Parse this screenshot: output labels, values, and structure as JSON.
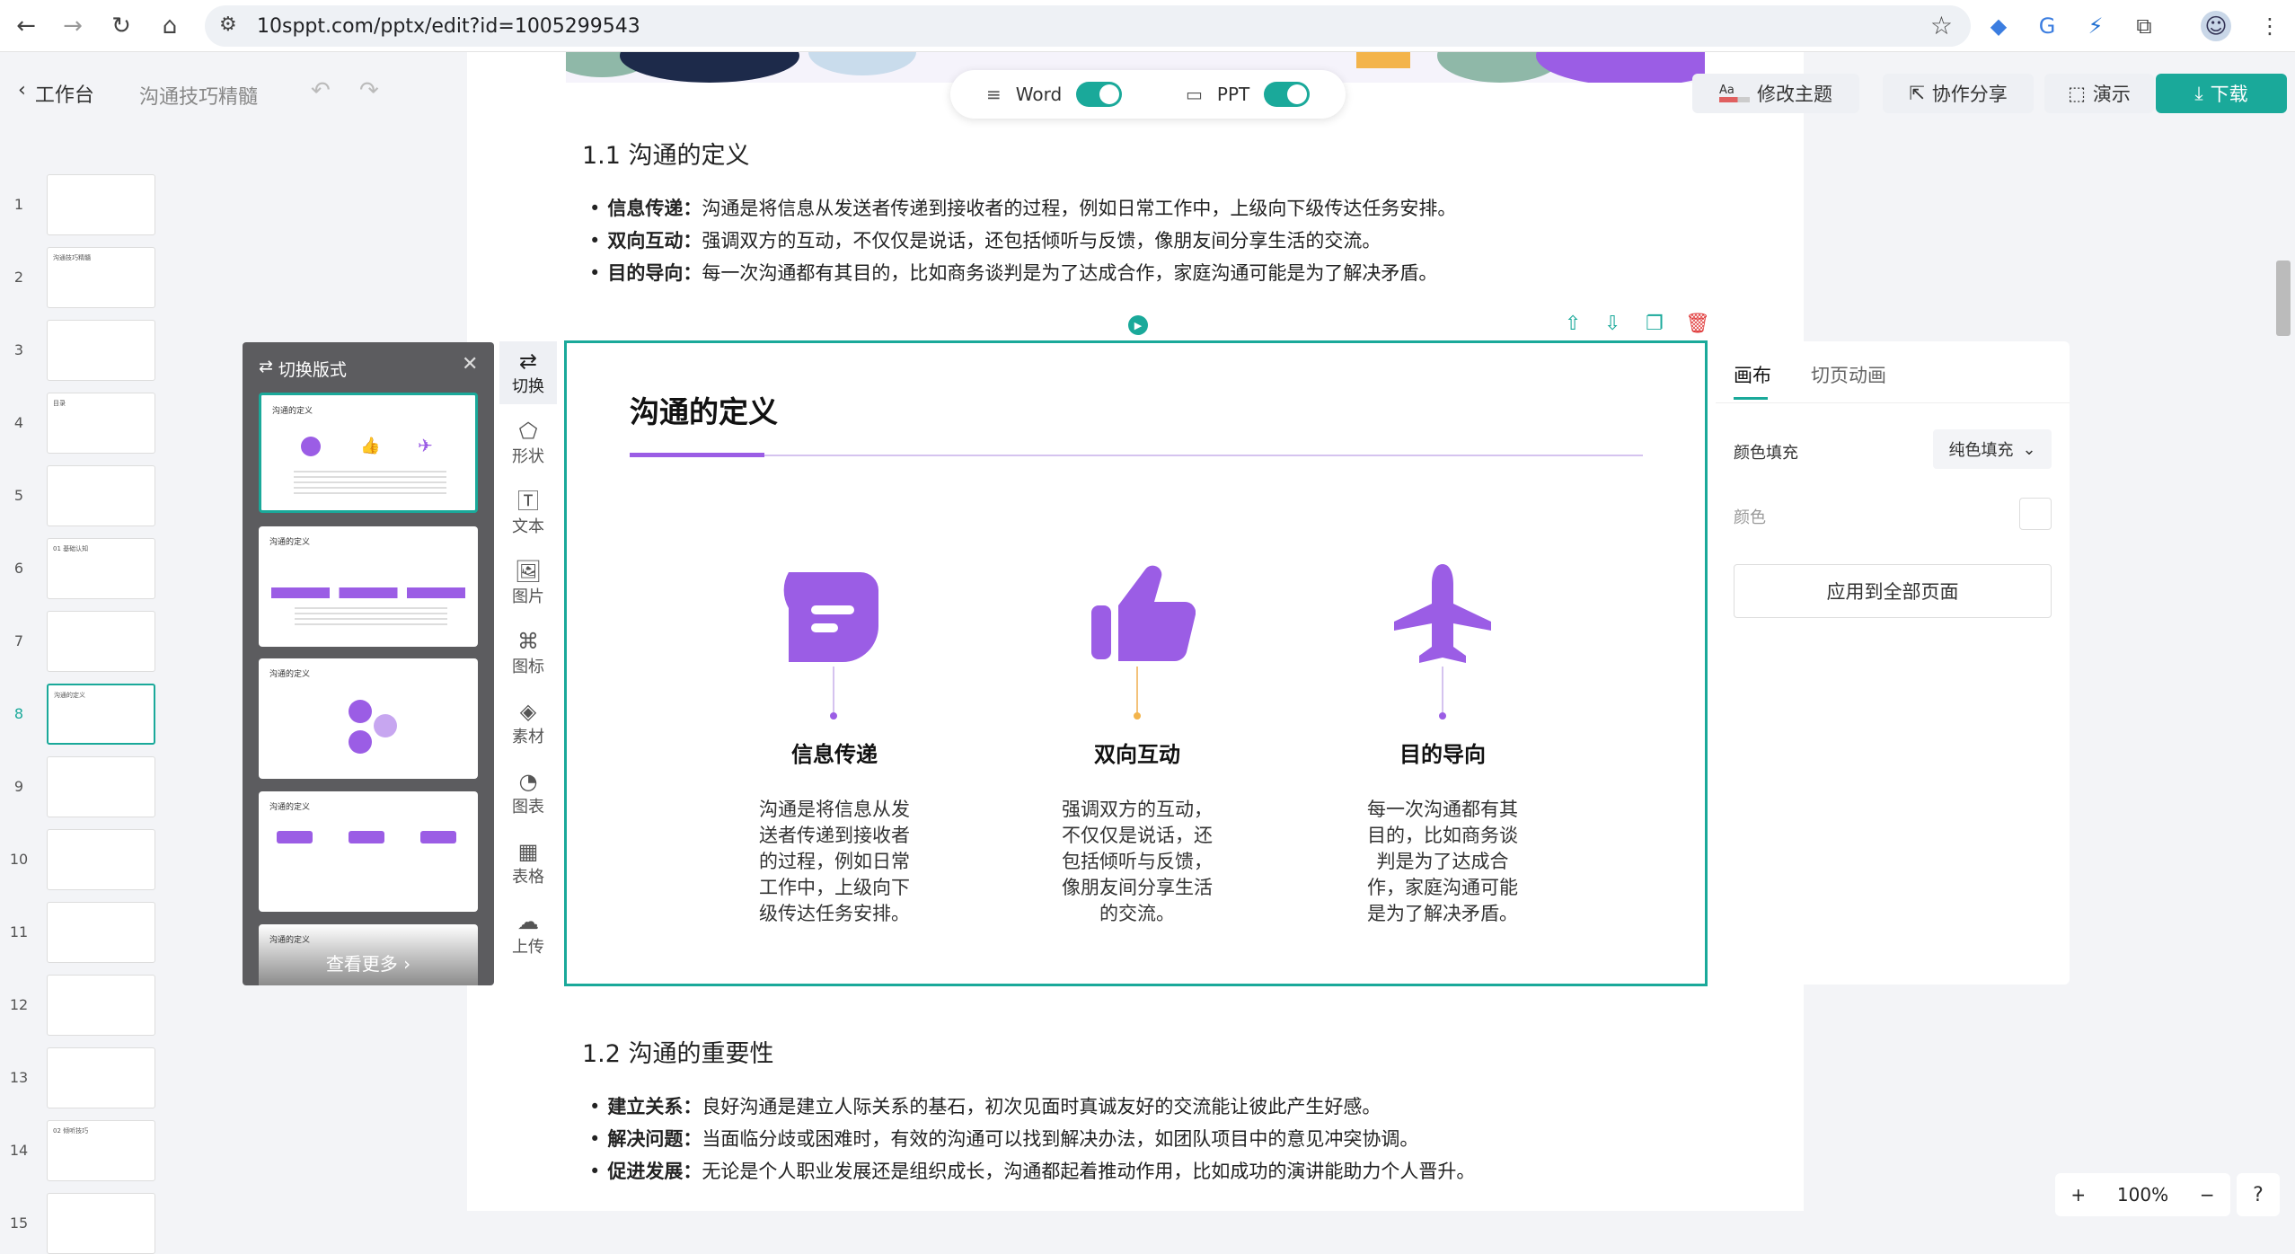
{
  "browser": {
    "url": "10sppt.com/pptx/edit?id=1005299543"
  },
  "header": {
    "workbench": "工作台",
    "doc_title": "沟通技巧精髓",
    "toggle_word": "Word",
    "toggle_ppt": "PPT",
    "theme_label": "修改主题",
    "theme_aa": "Aa",
    "share": "协作分享",
    "present": "演示",
    "download": "下载"
  },
  "thumbnails": [
    {
      "num": "1",
      "text": ""
    },
    {
      "num": "2",
      "text": "沟通技巧精髓"
    },
    {
      "num": "3",
      "text": ""
    },
    {
      "num": "4",
      "text": "目录"
    },
    {
      "num": "5",
      "text": ""
    },
    {
      "num": "6",
      "text": "01 基础认知"
    },
    {
      "num": "7",
      "text": ""
    },
    {
      "num": "8",
      "text": "沟通的定义"
    },
    {
      "num": "9",
      "text": ""
    },
    {
      "num": "10",
      "text": ""
    },
    {
      "num": "11",
      "text": ""
    },
    {
      "num": "12",
      "text": ""
    },
    {
      "num": "13",
      "text": ""
    },
    {
      "num": "14",
      "text": "02 倾听技巧"
    },
    {
      "num": "15",
      "text": ""
    }
  ],
  "doc": {
    "section1_title": "1.1 沟通的定义",
    "section1_items": [
      {
        "label": "信息传递：",
        "text": "沟通是将信息从发送者传递到接收者的过程，例如日常工作中，上级向下级传达任务安排。"
      },
      {
        "label": "双向互动：",
        "text": "强调双方的互动，不仅仅是说话，还包括倾听与反馈，像朋友间分享生活的交流。"
      },
      {
        "label": "目的导向：",
        "text": "每一次沟通都有其目的，比如商务谈判是为了达成合作，家庭沟通可能是为了解决矛盾。"
      }
    ],
    "section2_title": "1.2 沟通的重要性",
    "section2_items": [
      {
        "label": "建立关系：",
        "text": "良好沟通是建立人际关系的基石，初次见面时真诚友好的交流能让彼此产生好感。"
      },
      {
        "label": "解决问题：",
        "text": "当面临分歧或困难时，有效的沟通可以找到解决办法，如团队项目中的意见冲突协调。"
      },
      {
        "label": "促进发展：",
        "text": "无论是个人职业发展还是组织成长，沟通都起着推动作用，比如成功的演讲能助力个人晋升。"
      }
    ]
  },
  "switcher": {
    "title": "切换版式",
    "layout_title": "沟通的定义",
    "more": "查看更多"
  },
  "tools": [
    {
      "icon": "⇄",
      "label": "切换"
    },
    {
      "icon": "⬠",
      "label": "形状"
    },
    {
      "icon": "🅃",
      "label": "文本"
    },
    {
      "icon": "🖼",
      "label": "图片"
    },
    {
      "icon": "⌘",
      "label": "图标"
    },
    {
      "icon": "◈",
      "label": "素材"
    },
    {
      "icon": "◔",
      "label": "图表"
    },
    {
      "icon": "▦",
      "label": "表格"
    },
    {
      "icon": "☁",
      "label": "上传"
    }
  ],
  "slide": {
    "title": "沟通的定义",
    "columns": [
      {
        "title": "信息传递",
        "desc": "沟通是将信息从发送者传递到接收者的过程，例如日常工作中，上级向下级传达任务安排。",
        "icon": "chat-bubble-icon"
      },
      {
        "title": "双向互动",
        "desc": "强调双方的互动，不仅仅是说话，还包括倾听与反馈，像朋友间分享生活的交流。",
        "icon": "thumbs-up-icon"
      },
      {
        "title": "目的导向",
        "desc": "每一次沟通都有其目的，比如商务谈判是为了达成合作，家庭沟通可能是为了解决矛盾。",
        "icon": "airplane-icon"
      }
    ]
  },
  "rpanel": {
    "tab_canvas": "画布",
    "tab_anim": "切页动画",
    "fill_label": "颜色填充",
    "fill_value": "纯色填充",
    "color_label": "颜色",
    "apply_all": "应用到全部页面"
  },
  "zoom": {
    "plus": "+",
    "level": "100%",
    "minus": "−"
  },
  "colors": {
    "accent": "#1aa99a",
    "purple": "#9b5de5",
    "download_bg": "#1aa99a"
  }
}
